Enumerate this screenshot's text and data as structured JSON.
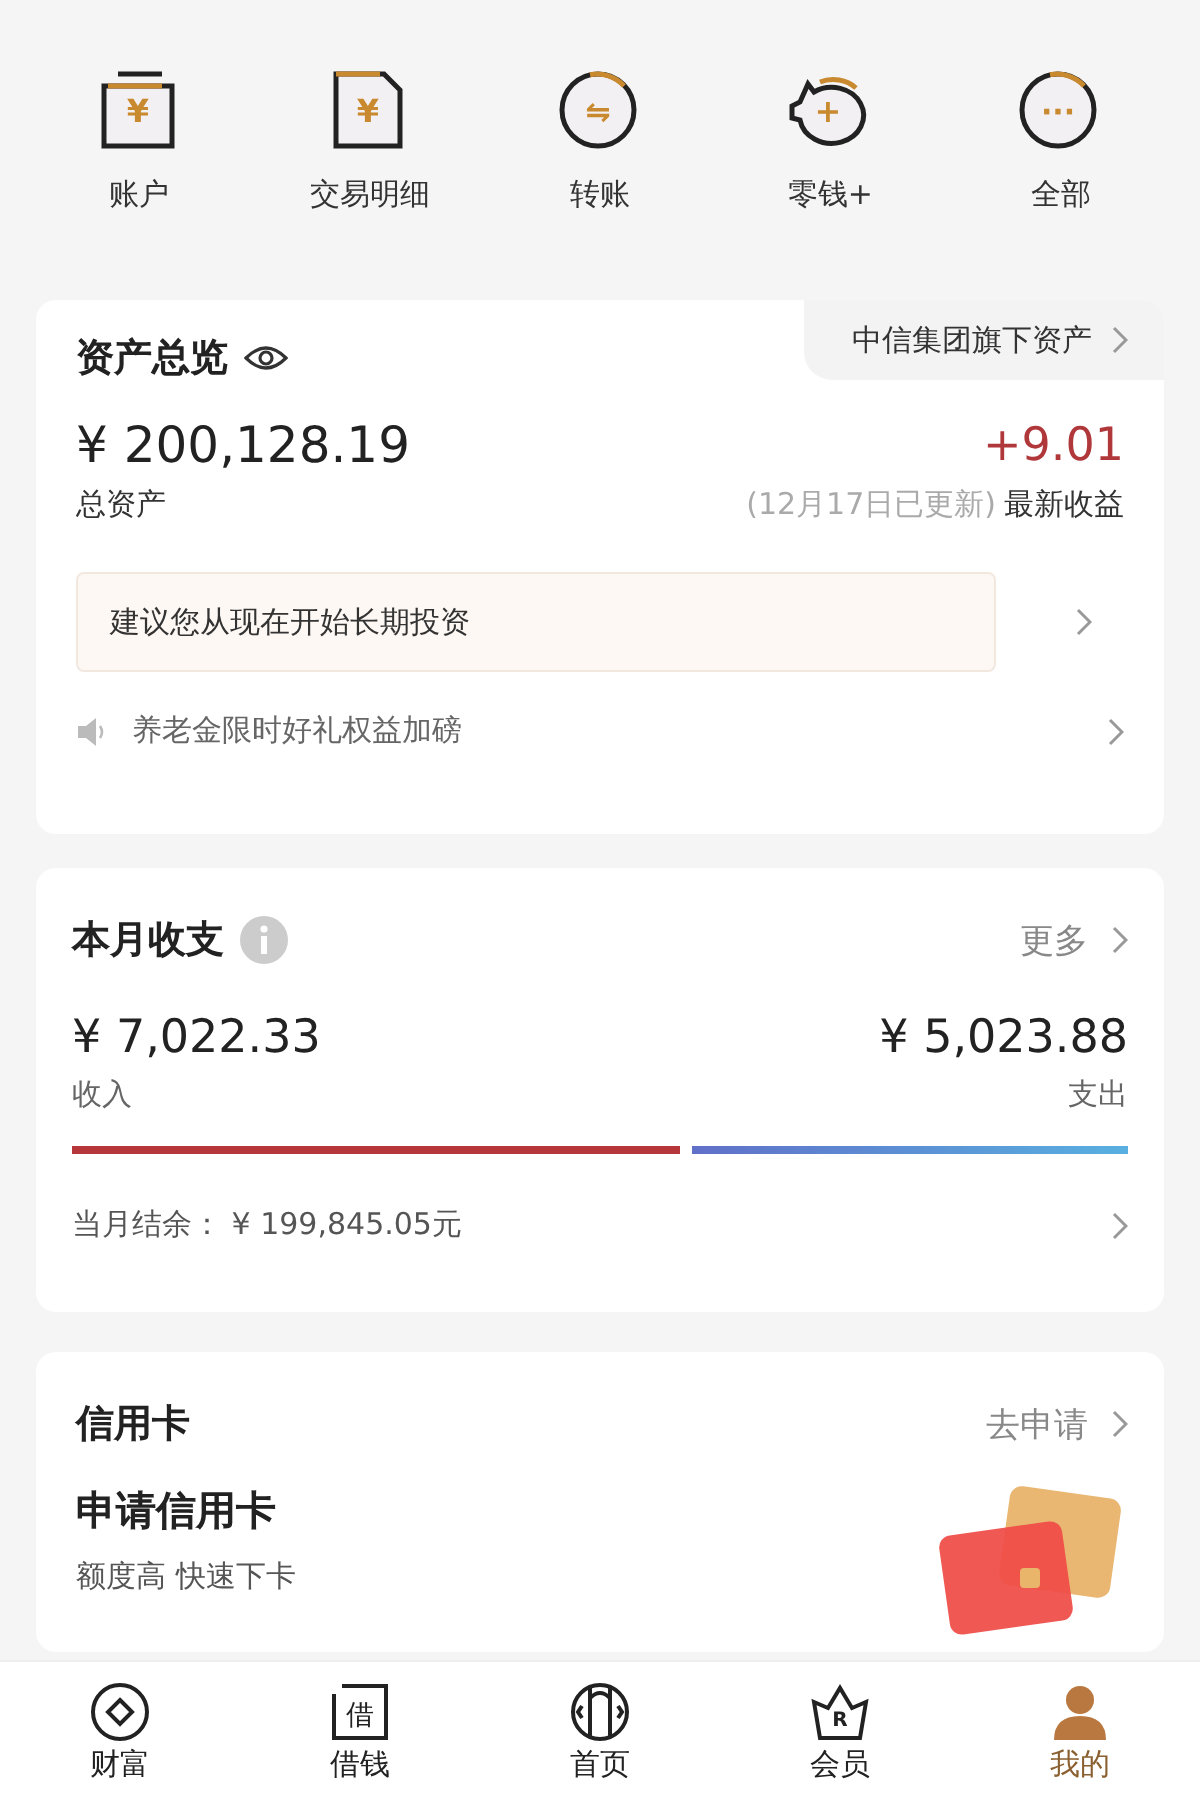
{
  "quick_actions": [
    {
      "label": "账户",
      "kind": "wallet",
      "glyph": "¥"
    },
    {
      "label": "交易明细",
      "kind": "document",
      "glyph": "¥"
    },
    {
      "label": "转账",
      "kind": "circle",
      "glyph": "⇋"
    },
    {
      "label": "零钱+",
      "kind": "piggy",
      "glyph": "+"
    },
    {
      "label": "全部",
      "kind": "circle",
      "glyph": "···"
    }
  ],
  "assets": {
    "title": "资产总览",
    "tab": "中信集团旗下资产",
    "amount": "¥ 200,128.19",
    "amount_label": "总资产",
    "earnings": "+9.01",
    "updated": "(12月17日已更新)",
    "earnings_label": "最新收益",
    "tip": "建议您从现在开始长期投资",
    "notice": "养老金限时好礼权益加磅"
  },
  "monthly": {
    "title": "本月收支",
    "more": "更多",
    "income": "¥ 7,022.33",
    "income_label": "收入",
    "expense": "¥ 5,023.88",
    "expense_label": "支出",
    "balance": "当月结余：  ¥  199,845.05元"
  },
  "credit_card": {
    "title": "信用卡",
    "action": "去申请",
    "headline": "申请信用卡",
    "subtitle": "额度高 快速下卡"
  },
  "nav": [
    {
      "label": "财富",
      "kind": "coin",
      "selected": false
    },
    {
      "label": "借钱",
      "kind": "square",
      "glyph": "借",
      "selected": false
    },
    {
      "label": "首页",
      "kind": "gate",
      "selected": false
    },
    {
      "label": "会员",
      "kind": "crown",
      "glyph": "R",
      "selected": false
    },
    {
      "label": "我的",
      "kind": "person",
      "selected": true
    }
  ]
}
